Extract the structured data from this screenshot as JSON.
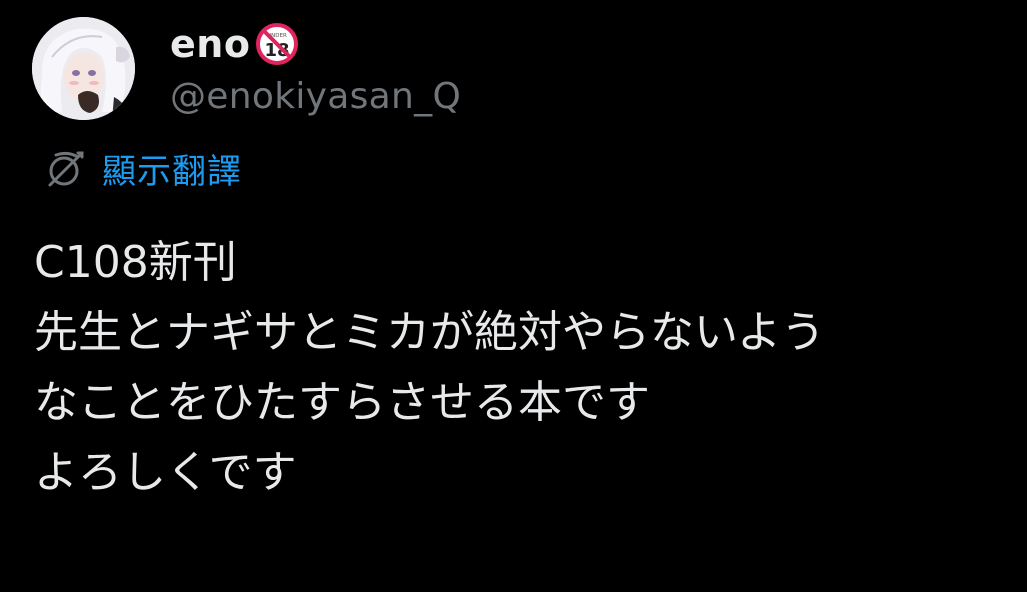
{
  "tweet": {
    "author": {
      "display_name": "eno",
      "badge_icon": "under18-icon",
      "handle": "@enokiyasan_Q",
      "avatar_icon": "avatar"
    },
    "translate": {
      "icon": "translate-globe-icon",
      "label": "顯示翻譯"
    },
    "body_lines": [
      "C108新刊",
      "先生とナギサとミカが絶対やらないよう",
      "なことをひたすらさせる本です",
      "よろしくです"
    ],
    "colors": {
      "background": "#000000",
      "text": "#e7e9ea",
      "secondary": "#71767b",
      "link": "#1d9bf0",
      "badge_red": "#e0245e"
    }
  }
}
